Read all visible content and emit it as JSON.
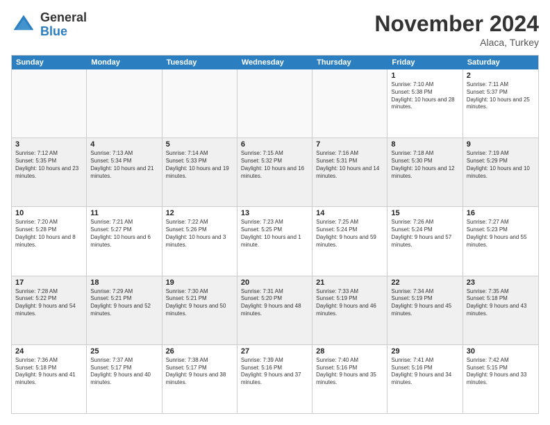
{
  "logo": {
    "general": "General",
    "blue": "Blue"
  },
  "title": "November 2024",
  "location": "Alaca, Turkey",
  "days": [
    "Sunday",
    "Monday",
    "Tuesday",
    "Wednesday",
    "Thursday",
    "Friday",
    "Saturday"
  ],
  "weeks": [
    [
      {
        "day": "",
        "text": ""
      },
      {
        "day": "",
        "text": ""
      },
      {
        "day": "",
        "text": ""
      },
      {
        "day": "",
        "text": ""
      },
      {
        "day": "",
        "text": ""
      },
      {
        "day": "1",
        "text": "Sunrise: 7:10 AM\nSunset: 5:38 PM\nDaylight: 10 hours and 28 minutes."
      },
      {
        "day": "2",
        "text": "Sunrise: 7:11 AM\nSunset: 5:37 PM\nDaylight: 10 hours and 25 minutes."
      }
    ],
    [
      {
        "day": "3",
        "text": "Sunrise: 7:12 AM\nSunset: 5:35 PM\nDaylight: 10 hours and 23 minutes."
      },
      {
        "day": "4",
        "text": "Sunrise: 7:13 AM\nSunset: 5:34 PM\nDaylight: 10 hours and 21 minutes."
      },
      {
        "day": "5",
        "text": "Sunrise: 7:14 AM\nSunset: 5:33 PM\nDaylight: 10 hours and 19 minutes."
      },
      {
        "day": "6",
        "text": "Sunrise: 7:15 AM\nSunset: 5:32 PM\nDaylight: 10 hours and 16 minutes."
      },
      {
        "day": "7",
        "text": "Sunrise: 7:16 AM\nSunset: 5:31 PM\nDaylight: 10 hours and 14 minutes."
      },
      {
        "day": "8",
        "text": "Sunrise: 7:18 AM\nSunset: 5:30 PM\nDaylight: 10 hours and 12 minutes."
      },
      {
        "day": "9",
        "text": "Sunrise: 7:19 AM\nSunset: 5:29 PM\nDaylight: 10 hours and 10 minutes."
      }
    ],
    [
      {
        "day": "10",
        "text": "Sunrise: 7:20 AM\nSunset: 5:28 PM\nDaylight: 10 hours and 8 minutes."
      },
      {
        "day": "11",
        "text": "Sunrise: 7:21 AM\nSunset: 5:27 PM\nDaylight: 10 hours and 6 minutes."
      },
      {
        "day": "12",
        "text": "Sunrise: 7:22 AM\nSunset: 5:26 PM\nDaylight: 10 hours and 3 minutes."
      },
      {
        "day": "13",
        "text": "Sunrise: 7:23 AM\nSunset: 5:25 PM\nDaylight: 10 hours and 1 minute."
      },
      {
        "day": "14",
        "text": "Sunrise: 7:25 AM\nSunset: 5:24 PM\nDaylight: 9 hours and 59 minutes."
      },
      {
        "day": "15",
        "text": "Sunrise: 7:26 AM\nSunset: 5:24 PM\nDaylight: 9 hours and 57 minutes."
      },
      {
        "day": "16",
        "text": "Sunrise: 7:27 AM\nSunset: 5:23 PM\nDaylight: 9 hours and 55 minutes."
      }
    ],
    [
      {
        "day": "17",
        "text": "Sunrise: 7:28 AM\nSunset: 5:22 PM\nDaylight: 9 hours and 54 minutes."
      },
      {
        "day": "18",
        "text": "Sunrise: 7:29 AM\nSunset: 5:21 PM\nDaylight: 9 hours and 52 minutes."
      },
      {
        "day": "19",
        "text": "Sunrise: 7:30 AM\nSunset: 5:21 PM\nDaylight: 9 hours and 50 minutes."
      },
      {
        "day": "20",
        "text": "Sunrise: 7:31 AM\nSunset: 5:20 PM\nDaylight: 9 hours and 48 minutes."
      },
      {
        "day": "21",
        "text": "Sunrise: 7:33 AM\nSunset: 5:19 PM\nDaylight: 9 hours and 46 minutes."
      },
      {
        "day": "22",
        "text": "Sunrise: 7:34 AM\nSunset: 5:19 PM\nDaylight: 9 hours and 45 minutes."
      },
      {
        "day": "23",
        "text": "Sunrise: 7:35 AM\nSunset: 5:18 PM\nDaylight: 9 hours and 43 minutes."
      }
    ],
    [
      {
        "day": "24",
        "text": "Sunrise: 7:36 AM\nSunset: 5:18 PM\nDaylight: 9 hours and 41 minutes."
      },
      {
        "day": "25",
        "text": "Sunrise: 7:37 AM\nSunset: 5:17 PM\nDaylight: 9 hours and 40 minutes."
      },
      {
        "day": "26",
        "text": "Sunrise: 7:38 AM\nSunset: 5:17 PM\nDaylight: 9 hours and 38 minutes."
      },
      {
        "day": "27",
        "text": "Sunrise: 7:39 AM\nSunset: 5:16 PM\nDaylight: 9 hours and 37 minutes."
      },
      {
        "day": "28",
        "text": "Sunrise: 7:40 AM\nSunset: 5:16 PM\nDaylight: 9 hours and 35 minutes."
      },
      {
        "day": "29",
        "text": "Sunrise: 7:41 AM\nSunset: 5:16 PM\nDaylight: 9 hours and 34 minutes."
      },
      {
        "day": "30",
        "text": "Sunrise: 7:42 AM\nSunset: 5:15 PM\nDaylight: 9 hours and 33 minutes."
      }
    ]
  ]
}
